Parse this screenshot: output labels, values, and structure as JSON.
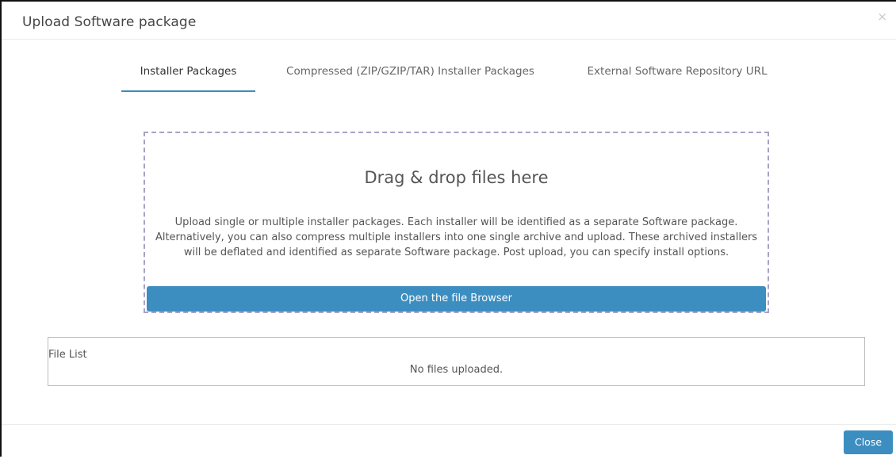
{
  "dialog": {
    "title": "Upload Software package",
    "close_glyph": "×"
  },
  "tabs": [
    {
      "label": "Installer Packages",
      "active": true
    },
    {
      "label": "Compressed (ZIP/GZIP/TAR) Installer Packages",
      "active": false
    },
    {
      "label": "External Software Repository URL",
      "active": false
    }
  ],
  "dropzone": {
    "title": "Drag & drop files here",
    "description": "Upload single or multiple installer packages. Each installer will be identified as a separate Software package. Alternatively, you can also compress multiple installers into one single archive and upload. These archived installers will be deflated and identified as separate Software package. Post upload, you can specify install options.",
    "browse_label": "Open the file Browser"
  },
  "file_list": {
    "label": "File List",
    "empty_text": "No files uploaded."
  },
  "footer": {
    "close_label": "Close"
  },
  "colors": {
    "accent": "#3c8ec0",
    "dropzone_border": "#a7a2c7",
    "active_tab_underline": "#3b8dbd"
  }
}
